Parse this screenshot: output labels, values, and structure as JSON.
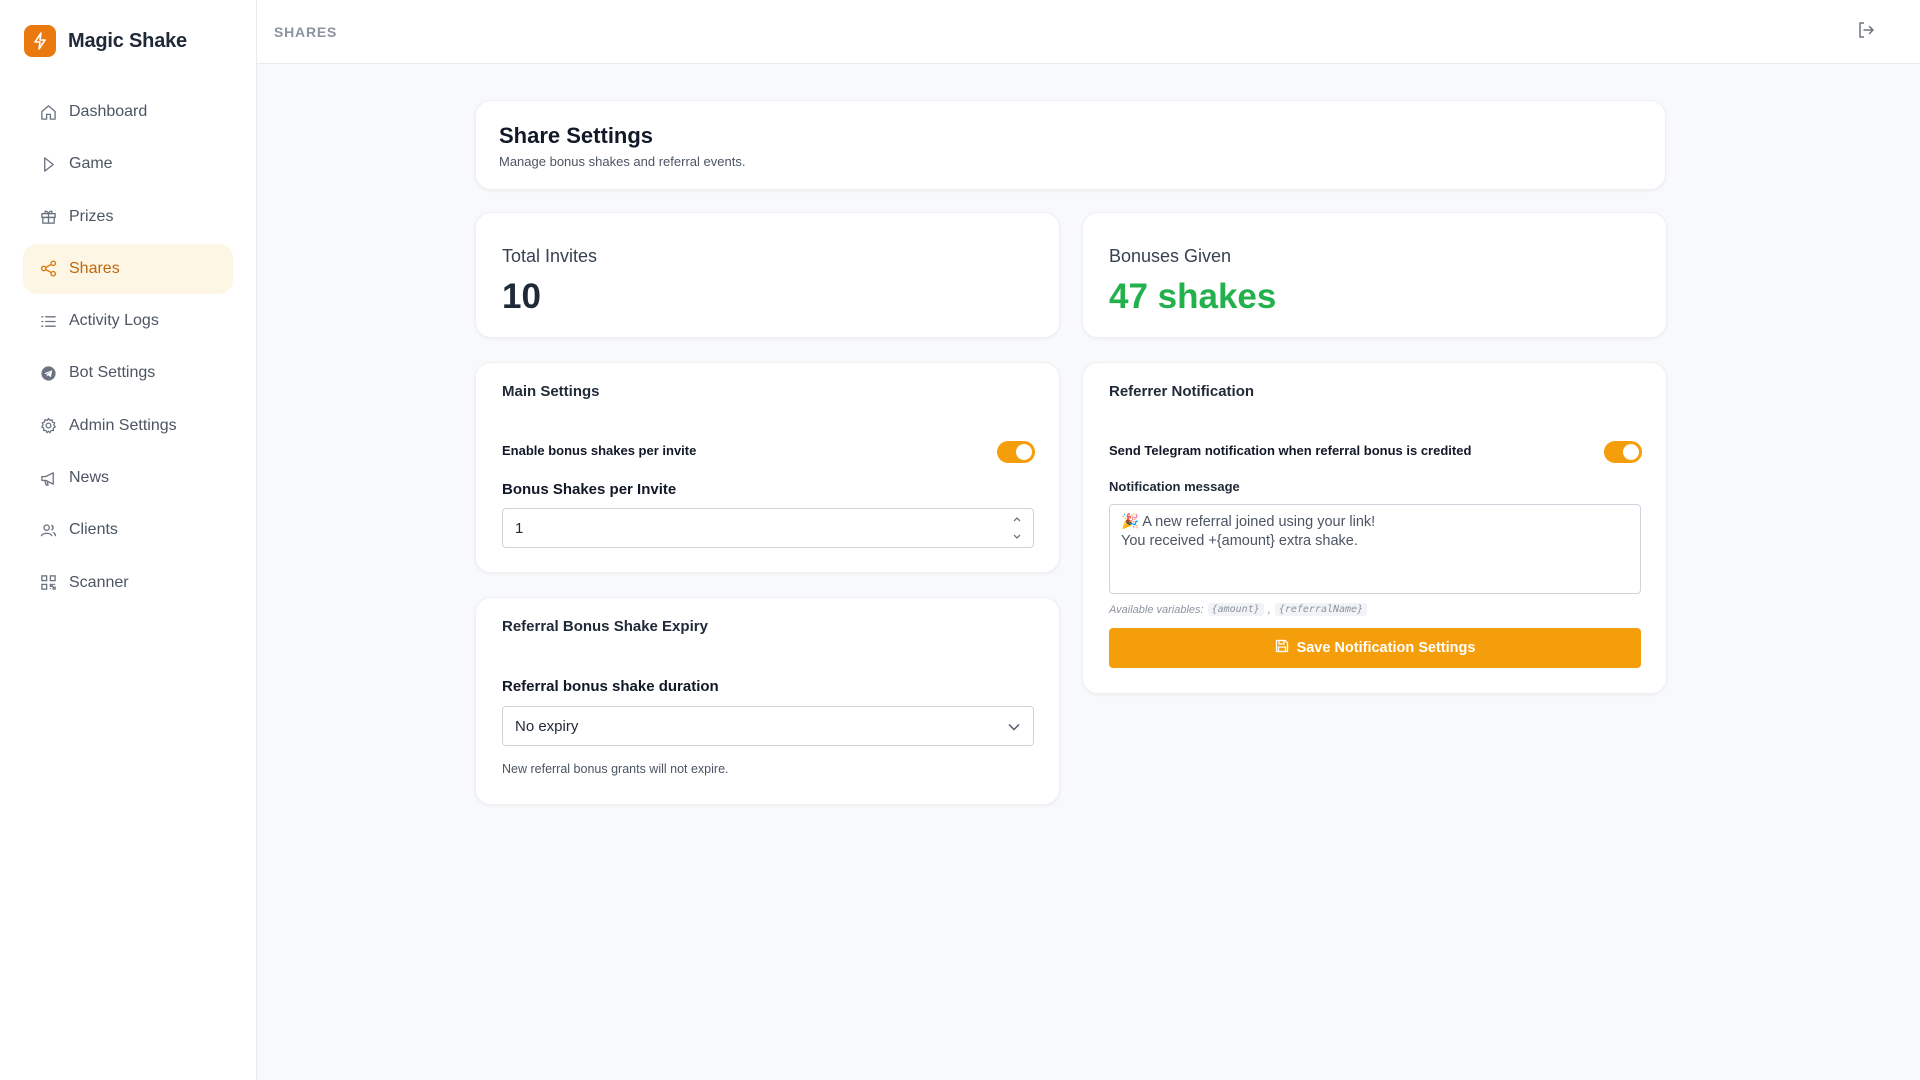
{
  "app": {
    "name": "Magic Shake"
  },
  "sidebar": {
    "items": [
      {
        "label": "Dashboard",
        "icon": "home-icon"
      },
      {
        "label": "Game",
        "icon": "play-icon"
      },
      {
        "label": "Prizes",
        "icon": "gift-icon"
      },
      {
        "label": "Shares",
        "icon": "share-icon",
        "active": true
      },
      {
        "label": "Activity Logs",
        "icon": "list-icon"
      },
      {
        "label": "Bot Settings",
        "icon": "telegram-icon"
      },
      {
        "label": "Admin Settings",
        "icon": "gear-icon"
      },
      {
        "label": "News",
        "icon": "megaphone-icon"
      },
      {
        "label": "Clients",
        "icon": "users-icon"
      },
      {
        "label": "Scanner",
        "icon": "qr-icon"
      }
    ]
  },
  "topbar": {
    "breadcrumb": "SHARES"
  },
  "page": {
    "title": "Share Settings",
    "subtitle": "Manage bonus shakes and referral events."
  },
  "stats": {
    "invites": {
      "label": "Total Invites",
      "value": "10"
    },
    "bonuses": {
      "label": "Bonuses Given",
      "value": "47 shakes"
    }
  },
  "main_settings": {
    "title": "Main Settings",
    "toggle_label": "Enable bonus shakes per invite",
    "toggle_on": true,
    "field_label": "Bonus Shakes per Invite",
    "field_value": "1"
  },
  "expiry": {
    "title": "Referral Bonus Shake Expiry",
    "field_label": "Referral bonus shake duration",
    "selected": "No expiry",
    "hint": "New referral bonus grants will not expire."
  },
  "notification": {
    "title": "Referrer Notification",
    "toggle_label": "Send Telegram notification when referral bonus is credited",
    "toggle_on": true,
    "message_label": "Notification message",
    "message": "🎉 A new referral joined using your link!\nYou received +{amount} extra shake.",
    "vars_prefix": "Available variables:",
    "var1": "{amount}",
    "var_sep": ",",
    "var2": "{referralName}",
    "save_label": "Save Notification Settings"
  },
  "colors": {
    "accent": "#f59e0b",
    "brand": "#ea7a0f",
    "success": "#22b14c"
  }
}
